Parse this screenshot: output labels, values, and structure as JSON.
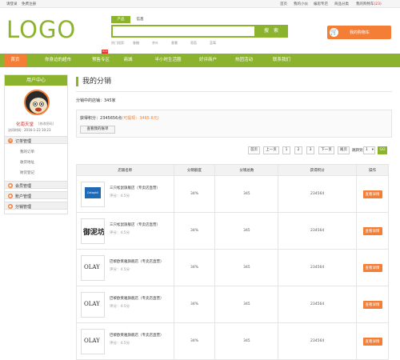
{
  "topbar": {
    "login": "请登录",
    "register": "免费注册",
    "home": "首页",
    "my_shop": "我的小伙",
    "my_store": "编思专店",
    "favorites": "商品分类",
    "my_cart": "我的购物车",
    "cart_count": "(23)"
  },
  "logo": "LOGO",
  "search": {
    "tabs": [
      "产品",
      "信息"
    ],
    "value": "",
    "button": "搜 索",
    "hot_label": "热门搜索:",
    "hot_terms": [
      "鲁糖",
      "茶叶",
      "番薯",
      "葡萄",
      "蓝莓"
    ]
  },
  "cart": {
    "label": "我的购物车",
    "count": "0",
    "icon": "cart-icon"
  },
  "nav": {
    "items": [
      "首页",
      "你身边的超市",
      "预售专区",
      "商城",
      "半小时生活圈",
      "好评商户",
      "热团活动",
      "联系我们"
    ],
    "hot_badge": "HOT"
  },
  "sidebar": {
    "title": "用户中心",
    "username": "化南天堂",
    "edit_profile": "[修改密码]",
    "last_visit": "访问时间：2016-1-23 10:23",
    "sections": [
      {
        "label": "订单管理",
        "icon": "order-icon",
        "items": [
          "我的订单",
          "收货地址",
          "财货登记"
        ]
      },
      {
        "label": "会员管理",
        "icon": "member-icon",
        "items": []
      },
      {
        "label": "账户管理",
        "icon": "account-icon",
        "items": []
      },
      {
        "label": "分销管理",
        "icon": "distribution-icon",
        "items": []
      }
    ]
  },
  "main": {
    "title": "我的分销",
    "store_count": "分销中的店铺：345家",
    "points_label": "获得积分：",
    "points_value": "2345656点",
    "withdraw": "(可提现：3465.6元)",
    "bill_button": "查看我的账单"
  },
  "pagination": {
    "first": "首页",
    "prev": "上一页",
    "pages": [
      "1",
      "2",
      "3"
    ],
    "next": "下一页",
    "last": "尾页",
    "goto": "跳转到",
    "current": "1",
    "go": "GO"
  },
  "table": {
    "headers": [
      "店铺名称",
      "分销额度",
      "分销总数",
      "获得积分",
      "操作"
    ],
    "rows": [
      {
        "name": "三只松鼠旗舰店（专卖店直营）",
        "rating": "评分：4.5分",
        "rate": "34%",
        "count": "345",
        "points": "234564",
        "action": "查看详情",
        "brand": "Cetaphil"
      },
      {
        "name": "三只松鼠旗舰店（专卖店直营）",
        "rating": "评分：4.5分",
        "rate": "34%",
        "count": "345",
        "points": "234564",
        "action": "查看详情",
        "brand": "御泥坊"
      },
      {
        "name": "巴黎欧莱雅旗舰店（专卖店直营）",
        "rating": "评分：4.5分",
        "rate": "34%",
        "count": "345",
        "points": "234564",
        "action": "查看详情",
        "brand": "OLAY"
      },
      {
        "name": "巴黎欧莱雅旗舰店（专卖店直营）",
        "rating": "评分：4.5分",
        "rate": "34%",
        "count": "345",
        "points": "234564",
        "action": "查看详情",
        "brand": "OLAY"
      },
      {
        "name": "巴黎欧莱雅旗舰店（专卖店直营）",
        "rating": "评分：4.5分",
        "rate": "34%",
        "count": "345",
        "points": "234564",
        "action": "查看详情",
        "brand": "OLAY"
      }
    ]
  }
}
